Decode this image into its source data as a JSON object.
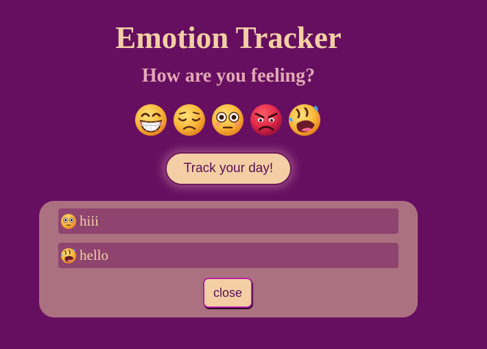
{
  "header": {
    "title": "Emotion Tracker",
    "subtitle": "How are you feeling?"
  },
  "emotions": [
    {
      "icon": "grinning-face-icon"
    },
    {
      "icon": "pensive-face-icon"
    },
    {
      "icon": "flushed-face-icon"
    },
    {
      "icon": "angry-face-icon"
    },
    {
      "icon": "rolling-laughing-face-icon"
    }
  ],
  "track_button": {
    "label": "Track your day!"
  },
  "entries": [
    {
      "icon": "flushed-face-icon",
      "text": "hiii"
    },
    {
      "icon": "rolling-laughing-face-icon",
      "text": "hello"
    }
  ],
  "close_button": {
    "label": "close"
  },
  "colors": {
    "background": "#660f60",
    "accent": "#f4cfa5",
    "panel": "#ac7181",
    "entry": "#8e446e"
  }
}
